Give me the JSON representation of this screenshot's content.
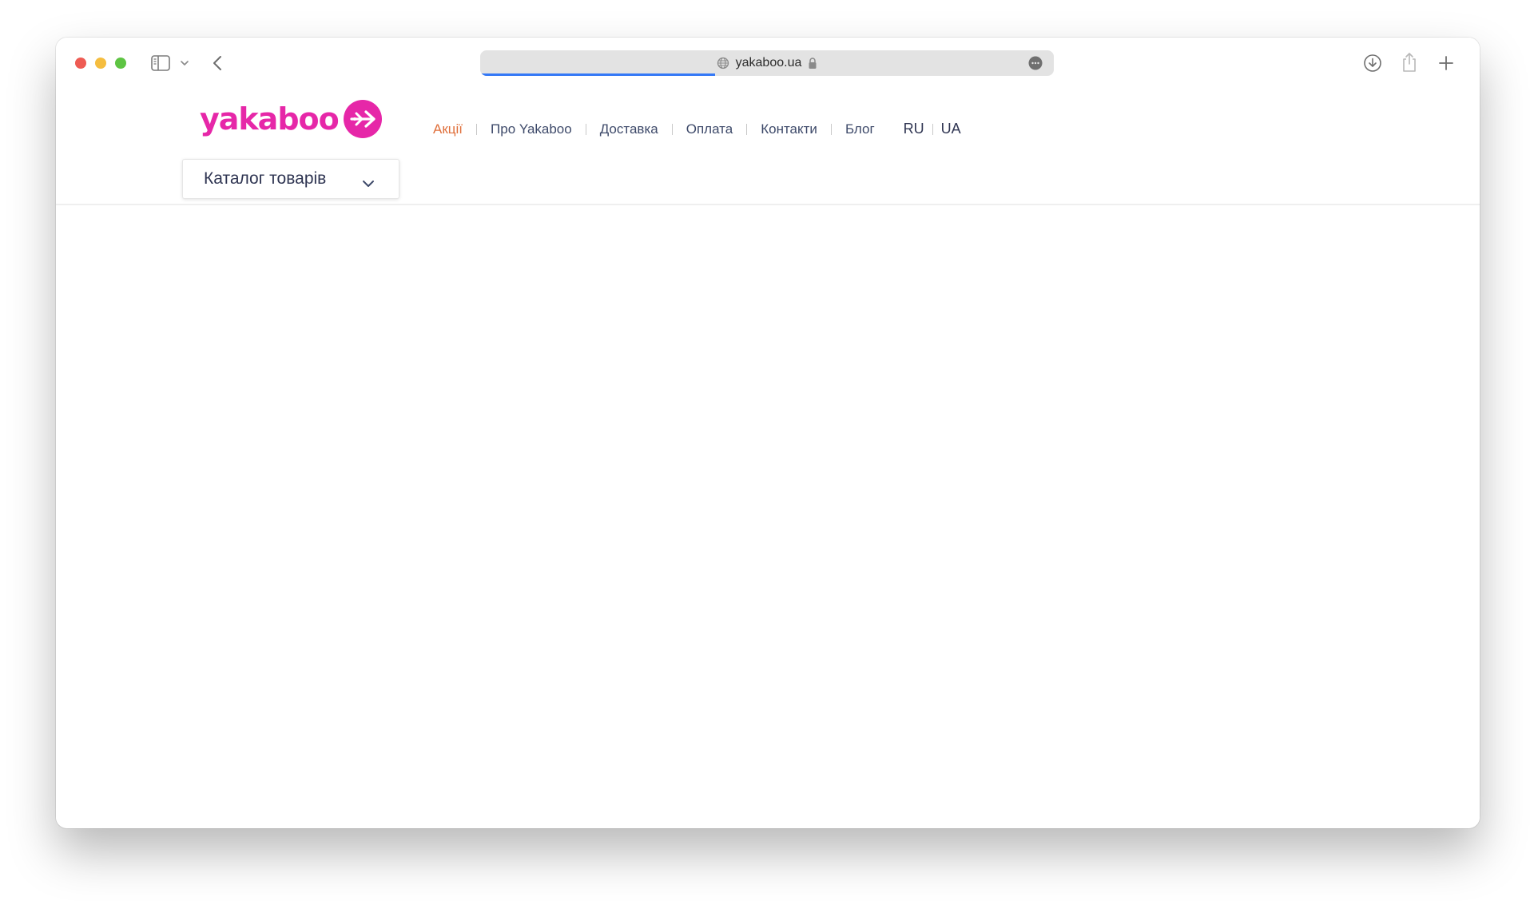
{
  "browser": {
    "url": "yakaboo.ua",
    "load_progress": 0.41
  },
  "site": {
    "logo_text": "yakaboo",
    "brand_color": "#e627a8",
    "nav": [
      {
        "label": "Акції",
        "promo": true
      },
      {
        "label": "Про Yakaboo"
      },
      {
        "label": "Доставка"
      },
      {
        "label": "Оплата"
      },
      {
        "label": "Контакти"
      },
      {
        "label": "Блог"
      }
    ],
    "lang": {
      "ru": "RU",
      "ua": "UA"
    },
    "catalog_label": "Каталог товарів"
  },
  "colors": {
    "promo": "#e0703c",
    "nav_text": "#3e4a6a",
    "accent_progress": "#3478f6"
  },
  "icons": {
    "sidebar": "sidebar-icon",
    "sidebar_menu": "chevron-down-icon",
    "back": "chevron-left-icon",
    "site_info": "globe-icon",
    "secure": "lock-icon",
    "page_menu": "more-icon",
    "download": "download-icon",
    "share": "share-icon",
    "new_tab": "plus-icon",
    "catalog_toggle": "chevron-down-icon"
  }
}
